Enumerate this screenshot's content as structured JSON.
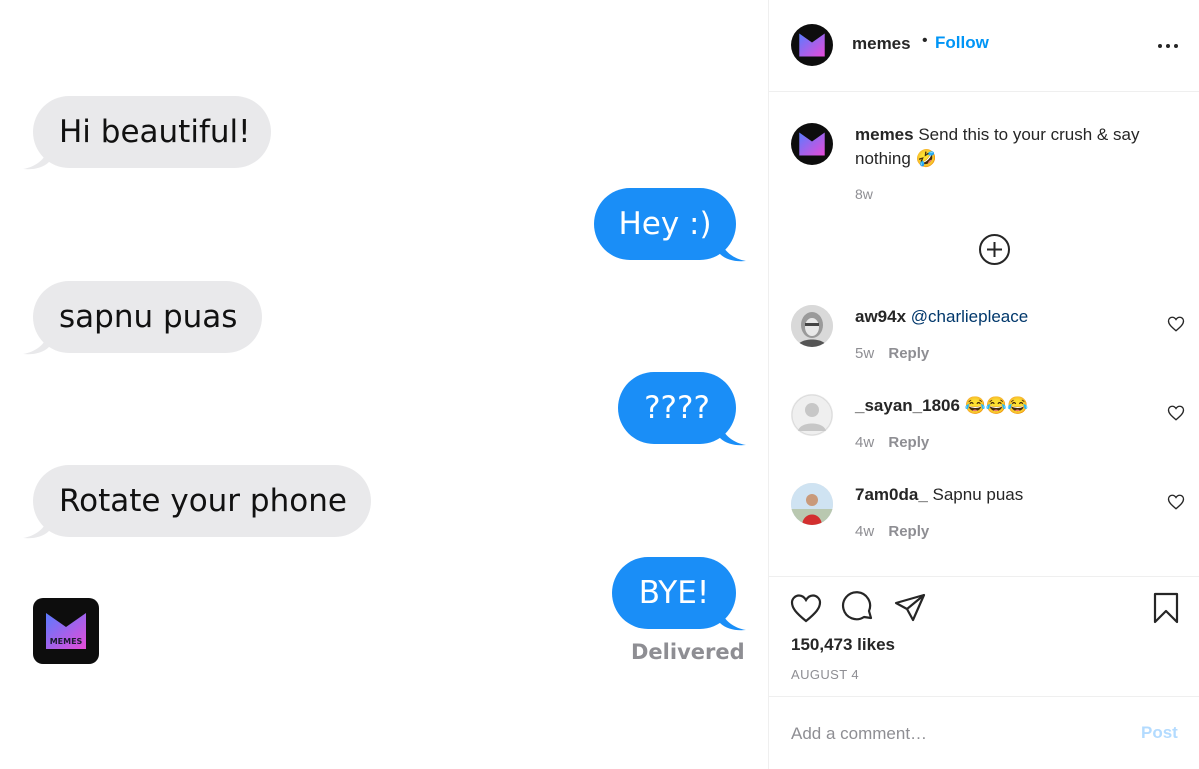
{
  "post_image": {
    "messages": [
      {
        "direction": "in",
        "text": "Hi beautiful!"
      },
      {
        "direction": "out",
        "text": "Hey :)"
      },
      {
        "direction": "in",
        "text": "sapnu puas"
      },
      {
        "direction": "out",
        "text": "????"
      },
      {
        "direction": "in",
        "text": "Rotate your phone"
      },
      {
        "direction": "out",
        "text": "BYE!"
      }
    ],
    "delivered_label": "Delivered",
    "logo_text": "MEMES"
  },
  "header": {
    "username": "memes",
    "separator": "•",
    "follow_label": "Follow",
    "more_icon": "more-options-icon"
  },
  "caption": {
    "username": "memes",
    "text": "Send this to your crush & say nothing 🤣",
    "time": "8w"
  },
  "load_more_icon": "plus-circle-icon",
  "comments": [
    {
      "username": "aw94x",
      "mention": "@charliepleace",
      "text": "",
      "time": "5w",
      "reply_label": "Reply"
    },
    {
      "username": "_sayan_1806",
      "mention": "",
      "text": "😂😂😂",
      "time": "4w",
      "reply_label": "Reply"
    },
    {
      "username": "7am0da_",
      "mention": "",
      "text": "Sapnu puas",
      "time": "4w",
      "reply_label": "Reply"
    }
  ],
  "actions": {
    "like_icon": "heart-icon",
    "comment_icon": "comment-icon",
    "share_icon": "paper-plane-icon",
    "save_icon": "bookmark-icon",
    "likes_text": "150,473 likes",
    "date": "AUGUST 4"
  },
  "comment_bar": {
    "placeholder": "Add a comment…",
    "post_label": "Post"
  },
  "colors": {
    "accent": "#0095f6",
    "imessage_blue": "#1a8ef7",
    "incoming_bubble": "#e9e9eb",
    "post_button_disabled": "#b3dbff",
    "logo_gradient_start": "#6a5cff",
    "logo_gradient_end": "#e64bd8"
  }
}
